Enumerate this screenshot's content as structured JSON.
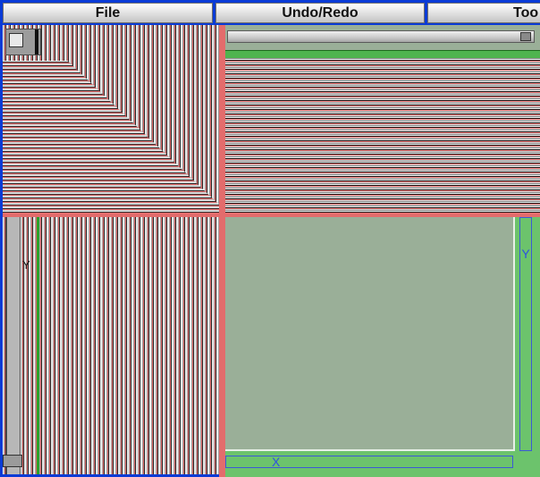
{
  "menu": {
    "file": "File",
    "undo_redo": "Undo/Redo",
    "tools": "Too"
  },
  "panes": {
    "bottom_left": {
      "axis_label": "Y"
    },
    "bottom_right": {
      "y_label": "Y",
      "x_label": "X"
    }
  },
  "colors": {
    "frame": "#0a3bd6",
    "divider": "#e36c6c",
    "plot_bg": "#9aaf98",
    "plot_frame": "#6cc36c",
    "axis_label": "#2f52e0"
  }
}
